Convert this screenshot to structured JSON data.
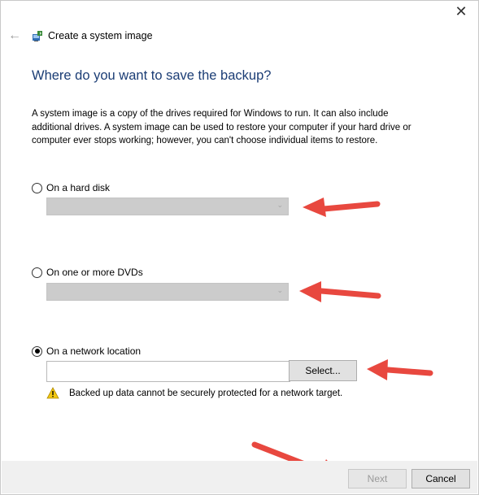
{
  "window": {
    "title": "Create a system image",
    "close_glyph": "✕",
    "back_glyph": "←"
  },
  "main": {
    "heading": "Where do you want to save the backup?",
    "description": "A system image is a copy of the drives required for Windows to run. It can also include additional drives. A system image can be used to restore your computer if your hard drive or computer ever stops working; however, you can't choose individual items to restore."
  },
  "options": {
    "hard_disk": {
      "label": "On a hard disk",
      "selected": false
    },
    "dvds": {
      "label": "On one or more DVDs",
      "selected": false
    },
    "network": {
      "label": "On a network location",
      "selected": true,
      "path_value": ""
    }
  },
  "buttons": {
    "select": "Select...",
    "next": "Next",
    "cancel": "Cancel"
  },
  "warning": {
    "text": "Backed up data cannot be securely protected for a network target.",
    "icon": "warning-icon"
  },
  "colors": {
    "heading": "#1b3d75",
    "annotation_arrow": "#e8483f",
    "footer_bg": "#f0f0f0",
    "disabled_dropdown": "#cccccc"
  }
}
